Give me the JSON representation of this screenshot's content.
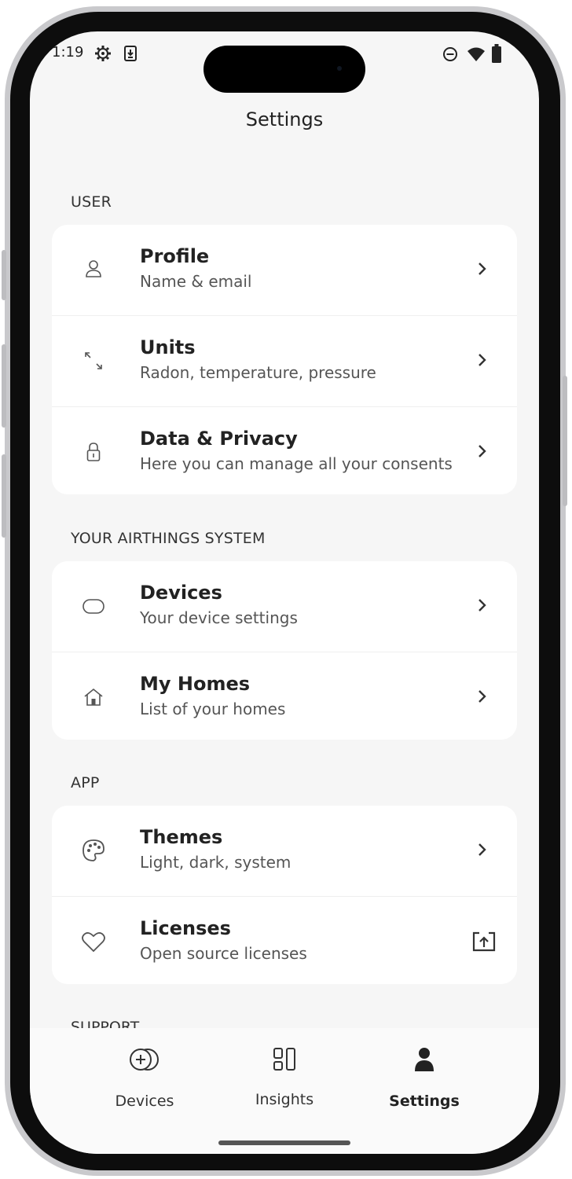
{
  "status_bar": {
    "time": "1:19",
    "left_icons": [
      "gear-icon",
      "download-icon"
    ],
    "right_icons": [
      "dnd-icon",
      "wifi-icon",
      "battery-icon"
    ]
  },
  "header": {
    "title": "Settings"
  },
  "sections": [
    {
      "header": "USER",
      "items": [
        {
          "title": "Profile",
          "subtitle": "Name & email",
          "icon": "person-icon",
          "action": "chevron"
        },
        {
          "title": "Units",
          "subtitle": "Radon, temperature, pressure",
          "icon": "resize-arrows-icon",
          "action": "chevron"
        },
        {
          "title": "Data & Privacy",
          "subtitle": "Here you can manage all your consents",
          "icon": "lock-icon",
          "action": "chevron"
        }
      ]
    },
    {
      "header": "YOUR AIRTHINGS SYSTEM",
      "items": [
        {
          "title": "Devices",
          "subtitle": "Your device settings",
          "icon": "device-icon",
          "action": "chevron"
        },
        {
          "title": "My Homes",
          "subtitle": "List of your homes",
          "icon": "house-icon",
          "action": "chevron"
        }
      ]
    },
    {
      "header": "APP",
      "items": [
        {
          "title": "Themes",
          "subtitle": "Light, dark, system",
          "icon": "palette-icon",
          "action": "chevron"
        },
        {
          "title": "Licenses",
          "subtitle": "Open source licenses",
          "icon": "heart-icon",
          "action": "external-link"
        }
      ]
    }
  ],
  "support_header": "SUPPORT",
  "tab_bar": {
    "tabs": [
      {
        "label": "Devices",
        "icon": "add-device-icon",
        "active": false
      },
      {
        "label": "Insights",
        "icon": "insights-icon",
        "active": false
      },
      {
        "label": "Settings",
        "icon": "person-filled-icon",
        "active": true
      }
    ]
  },
  "colors": {
    "background": "#f6f6f6",
    "card": "#ffffff",
    "text": "#222222",
    "subtext": "#555555"
  }
}
